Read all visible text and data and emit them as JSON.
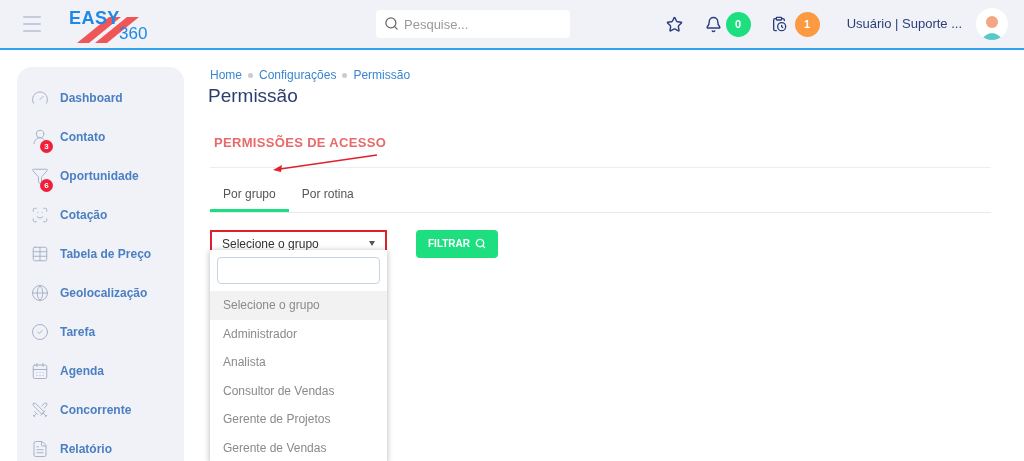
{
  "header": {
    "logo": {
      "word": "EASY",
      "number": "360"
    },
    "search": {
      "placeholder": "Pesquise..."
    },
    "notifications": {
      "count": "0"
    },
    "tasks": {
      "count": "1"
    },
    "user": "Usuário | Suporte ..."
  },
  "sidebar": {
    "items": [
      {
        "label": "Dashboard"
      },
      {
        "label": "Contato",
        "badge": "3"
      },
      {
        "label": "Oportunidade",
        "badge": "6"
      },
      {
        "label": "Cotação"
      },
      {
        "label": "Tabela de Preço"
      },
      {
        "label": "Geolocalização"
      },
      {
        "label": "Tarefa"
      },
      {
        "label": "Agenda"
      },
      {
        "label": "Concorrente"
      },
      {
        "label": "Relatório"
      }
    ]
  },
  "breadcrumb": [
    "Home",
    "Configurações",
    "Permissão"
  ],
  "page_title": "Permissão",
  "section_title": "PERMISSÕES DE ACESSO",
  "tabs": [
    {
      "label": "Por grupo",
      "selected": true
    },
    {
      "label": "Por rotina",
      "selected": false
    }
  ],
  "group_select": {
    "value": "Selecione o grupo",
    "open": true
  },
  "filter_button": "FILTRAR",
  "dropdown": {
    "options": [
      {
        "label": "Selecione o grupo",
        "selected": true
      },
      {
        "label": "Administrador",
        "selected": false
      },
      {
        "label": "Analista",
        "selected": false
      },
      {
        "label": "Consultor de Vendas",
        "selected": false
      },
      {
        "label": "Gerente de Projetos",
        "selected": false
      },
      {
        "label": "Gerente de Vendas",
        "selected": false
      }
    ]
  }
}
